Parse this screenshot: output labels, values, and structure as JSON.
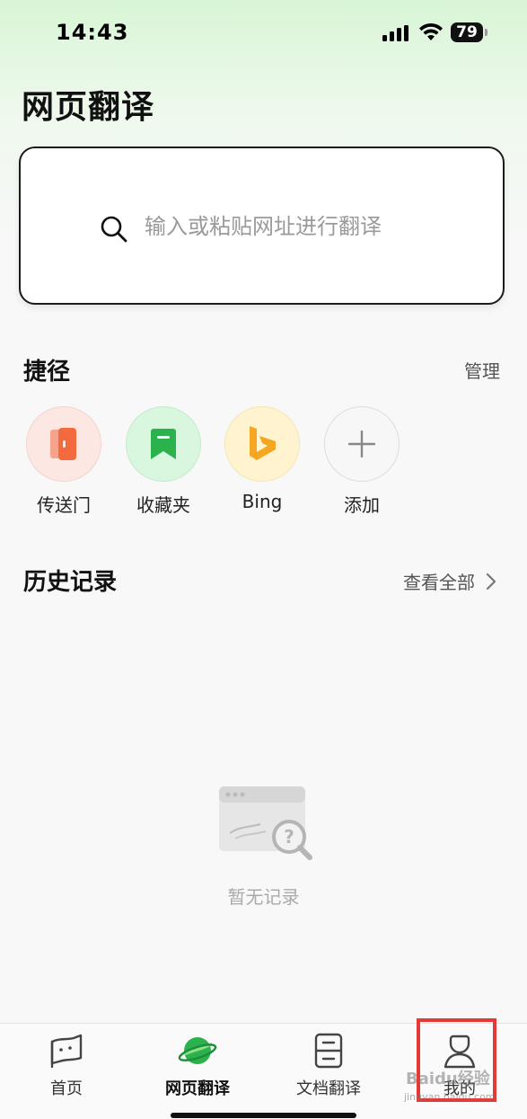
{
  "status_bar": {
    "time": "14:43",
    "battery": "79"
  },
  "page": {
    "title": "网页翻译"
  },
  "search": {
    "placeholder": "输入或粘贴网址进行翻译"
  },
  "shortcuts": {
    "title": "捷径",
    "manage_label": "管理",
    "items": [
      {
        "label": "传送门",
        "icon": "portal-icon",
        "color": "#f26a3d"
      },
      {
        "label": "收藏夹",
        "icon": "bookmark-icon",
        "color": "#2bb24c"
      },
      {
        "label": "Bing",
        "icon": "bing-icon",
        "color": "#f5a623"
      },
      {
        "label": "添加",
        "icon": "plus-icon",
        "color": "#888888"
      }
    ]
  },
  "history": {
    "title": "历史记录",
    "view_all_label": "查看全部",
    "empty_text": "暂无记录"
  },
  "bottom_nav": {
    "items": [
      {
        "label": "首页",
        "icon": "home-flag-icon"
      },
      {
        "label": "网页翻译",
        "icon": "planet-icon",
        "active": true
      },
      {
        "label": "文档翻译",
        "icon": "document-icon"
      },
      {
        "label": "我的",
        "icon": "user-icon"
      }
    ]
  },
  "watermark": {
    "text": "Baidu经验",
    "subtext": "jingyan.baidu.com"
  },
  "colors": {
    "accent_green": "#2bb24c",
    "highlight_red": "#e53935"
  }
}
